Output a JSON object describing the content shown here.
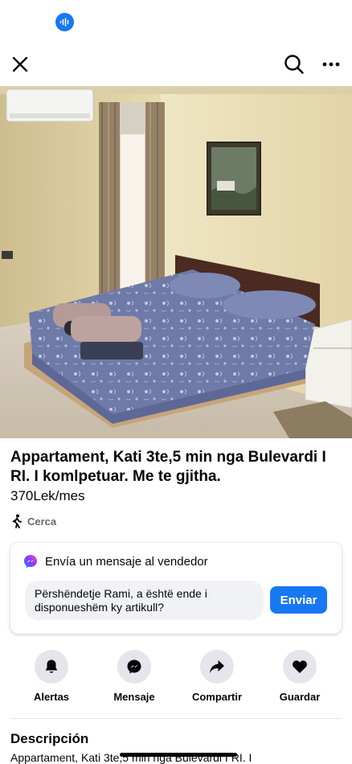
{
  "status": {
    "mic_icon": "waveform-icon",
    "accent": "#1877f2"
  },
  "nav": {
    "close_icon": "close-icon",
    "search_icon": "search-icon",
    "more_icon": "more-horizontal-icon"
  },
  "listing": {
    "photo_alt": "bedroom-photo",
    "title": "Appartament, Kati 3te,5 min nga Bulevardi I RI. I komlpetuar. Me te gjitha.",
    "price": "370Lek/mes",
    "location_label": "Cerca",
    "location_icon": "walking-person-icon"
  },
  "message": {
    "header": "Envía un mensaje al vendedor",
    "header_icon": "messenger-icon",
    "input_value": "Përshëndetje Rami, a është ende i disponueshëm ky artikull?",
    "send_label": "Enviar"
  },
  "actions": [
    {
      "label": "Alertas",
      "icon": "bell-icon"
    },
    {
      "label": "Mensaje",
      "icon": "messenger-icon"
    },
    {
      "label": "Compartir",
      "icon": "share-arrow-icon"
    },
    {
      "label": "Guardar",
      "icon": "heart-icon"
    }
  ],
  "description": {
    "heading": "Descripción",
    "text": "Appartament, Kati 3te,5 min nga Bulevardi I RI. I"
  },
  "colors": {
    "primary": "#1877f2",
    "secondary_text": "#65676b",
    "button_bg": "#e4e6eb",
    "input_bg": "#f0f2f5"
  }
}
